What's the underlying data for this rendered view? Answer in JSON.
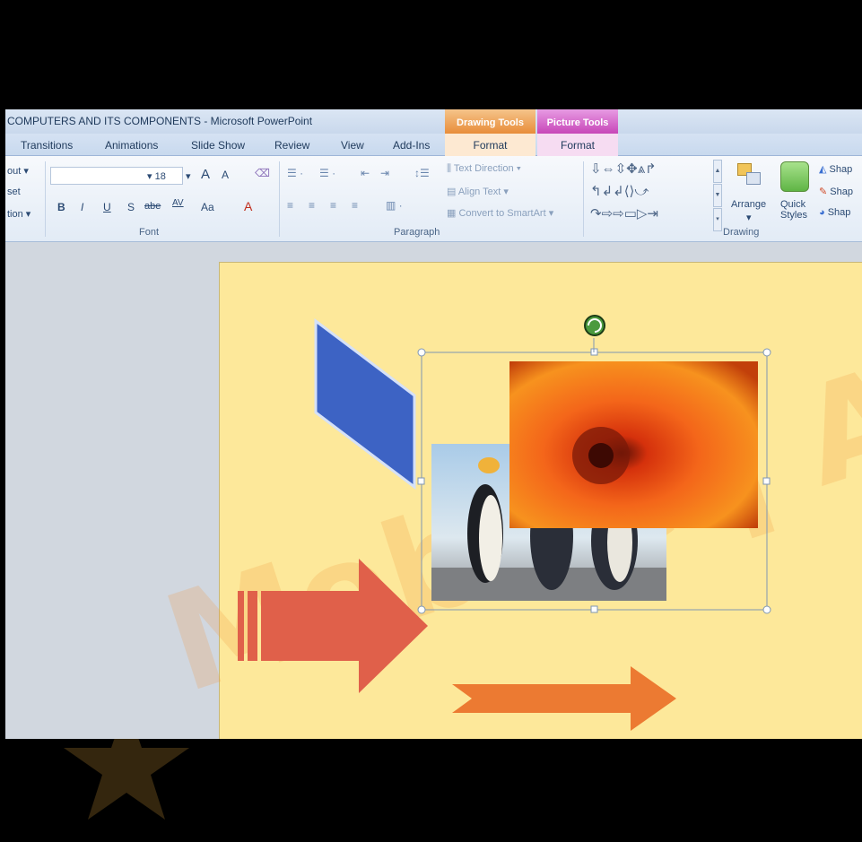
{
  "window": {
    "title": "COMPUTERS AND ITS COMPONENTS - Microsoft PowerPoint",
    "context_tabs": [
      "Drawing Tools",
      "Picture Tools"
    ]
  },
  "tabs": {
    "transitions": "Transitions",
    "animations": "Animations",
    "slide_show": "Slide Show",
    "review": "Review",
    "view": "View",
    "addins": "Add-Ins",
    "format_drawing": "Format",
    "format_picture": "Format"
  },
  "ribbon": {
    "slides": {
      "layout": "out",
      "reset": "set",
      "section": "tion"
    },
    "font": {
      "size": "18",
      "grow": "A",
      "shrink": "A",
      "bold": "B",
      "italic": "I",
      "underline": "U",
      "shadow": "S",
      "strike": "abe",
      "spacing": "AV",
      "case": "Aa",
      "color": "A",
      "label": "Font"
    },
    "paragraph": {
      "text_direction": "Text Direction",
      "align_text": "Align Text",
      "convert_smartart": "Convert to SmartArt",
      "label": "Paragraph"
    },
    "drawing": {
      "arrange": "Arrange",
      "quick_styles": "Quick Styles",
      "shape_fill": "Shap",
      "shape_outline": "Shap",
      "shape_effects": "Shap",
      "label": "Drawing"
    }
  },
  "watermark": {
    "text": "Mobiteq Academy"
  },
  "colors": {
    "slide_bg": "#fde89a",
    "drawing_tools": "#e88d3a",
    "picture_tools": "#c746b8",
    "arrow_red": "#e0604a",
    "arrow_orange": "#ec7a32",
    "parallelogram": "#3d63c4"
  },
  "icons": [
    "rotate-handle-icon",
    "shape-arrow-icons",
    "arrange-icon",
    "quick-styles-icon",
    "star-icon"
  ]
}
